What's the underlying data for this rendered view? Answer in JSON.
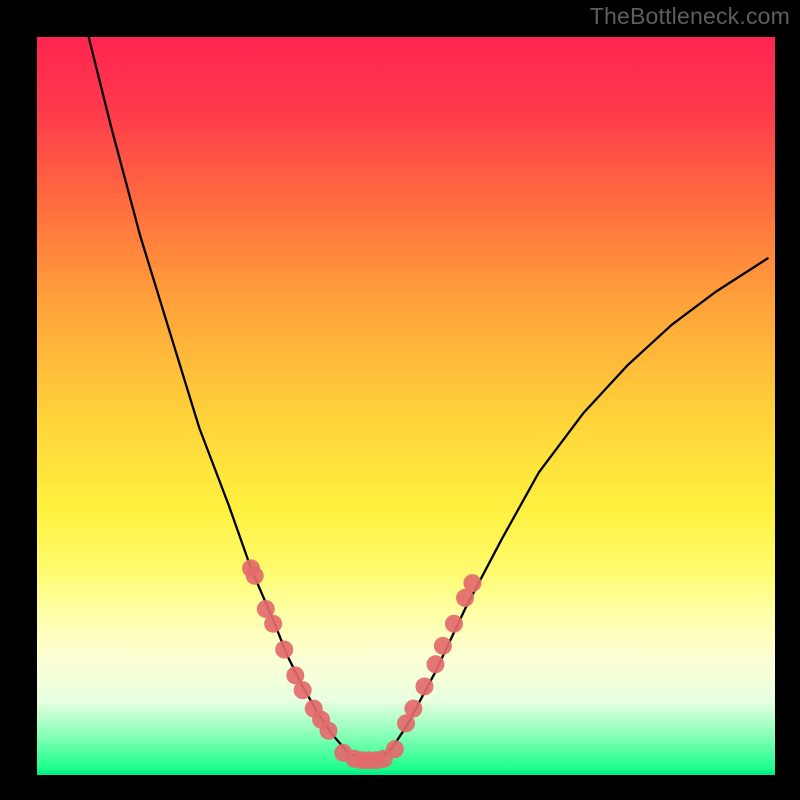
{
  "watermark": "TheBottleneck.com",
  "chart_data": {
    "type": "line",
    "title": "",
    "xlabel": "",
    "ylabel": "",
    "xlim": [
      0,
      100
    ],
    "ylim": [
      0,
      100
    ],
    "notes": "Bottleneck-style V/U curve with scattered markers near the minimum. Plot background is a vertical rainbow gradient (red→yellow→green). Black frame. No axis ticks or numeric labels are visible.",
    "series": [
      {
        "name": "curve",
        "type": "line",
        "color": "#000000",
        "x": [
          7,
          10,
          14,
          18,
          22,
          26,
          29,
          32,
          34,
          36,
          38,
          40,
          42,
          44,
          46,
          48,
          50,
          54,
          58,
          63,
          68,
          74,
          80,
          86,
          92,
          99
        ],
        "y": [
          100,
          88,
          73,
          60,
          47,
          36.5,
          28,
          21,
          16,
          12,
          8.5,
          5.5,
          3.2,
          2,
          2,
          3.5,
          6.5,
          14,
          22.5,
          32,
          41,
          49,
          55.5,
          61,
          65.5,
          70
        ]
      },
      {
        "name": "markers-left",
        "type": "scatter",
        "color": "#e36a6b",
        "x": [
          29.0,
          29.5,
          31.0,
          32.0,
          33.5,
          35.0,
          36.0,
          37.5,
          38.5,
          39.5
        ],
        "y": [
          28.0,
          27.0,
          22.5,
          20.5,
          17.0,
          13.5,
          11.5,
          9.0,
          7.5,
          6.0
        ]
      },
      {
        "name": "markers-bottom",
        "type": "scatter",
        "color": "#e36a6b",
        "x": [
          41.5,
          43.0,
          44.0,
          45.0,
          46.0,
          47.0,
          48.5
        ],
        "y": [
          3.0,
          2.2,
          2.0,
          2.0,
          2.0,
          2.2,
          3.5
        ]
      },
      {
        "name": "markers-right",
        "type": "scatter",
        "color": "#e36a6b",
        "x": [
          50.0,
          51.0,
          52.5,
          54.0,
          55.0,
          56.5,
          58.0,
          59.0
        ],
        "y": [
          7.0,
          9.0,
          12.0,
          15.0,
          17.5,
          20.5,
          24.0,
          26.0
        ]
      }
    ]
  }
}
